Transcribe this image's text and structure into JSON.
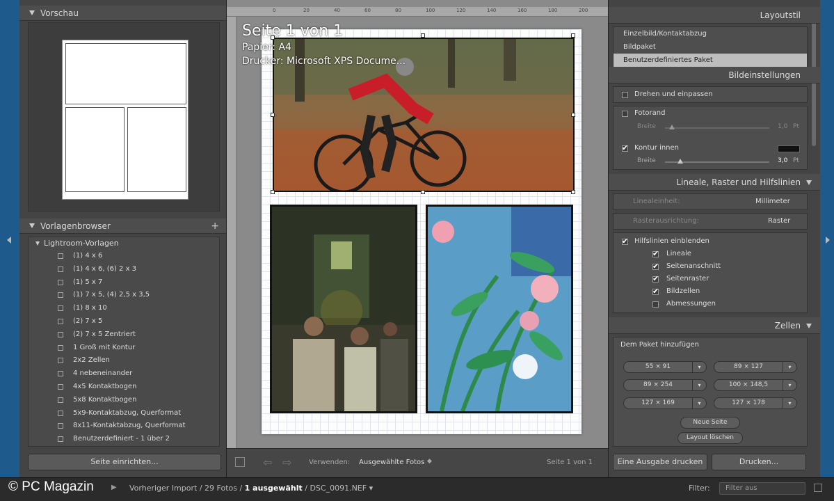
{
  "left_panel": {
    "preview_title": "Vorschau",
    "templates_title": "Vorlagenbrowser",
    "add_template": "+",
    "folder_name": "Lightroom-Vorlagen",
    "templates": [
      "(1) 4 x 6",
      "(1) 4 x 6, (6) 2 x 3",
      "(1) 5 x 7",
      "(1) 7 x 5, (4) 2,5 x 3,5",
      "(1) 8 x 10",
      "(2) 7 x 5",
      "(2) 7 x 5 Zentriert",
      "1 Groß mit Kontur",
      "2x2 Zellen",
      "4 nebeneinander",
      "4x5 Kontaktbogen",
      "5x8 Kontaktbogen",
      "5x9-Kontaktabzug, Querformat",
      "8x11-Kontaktabzug, Querformat",
      "Benutzerdefiniert - 1 über 2"
    ],
    "page_setup_button": "Seite einrichten..."
  },
  "center": {
    "page_title": "Seite 1 von 1",
    "paper": "Papier:  A4",
    "printer": "Drucker:  Microsoft XPS Docume...",
    "ruler_ticks": [
      "0",
      "20",
      "40",
      "60",
      "80",
      "100",
      "120",
      "140",
      "160",
      "180",
      "200"
    ],
    "use_label": "Verwenden:",
    "use_value": "Ausgewählte Fotos",
    "page_count": "Seite 1 von 1"
  },
  "right_panel": {
    "layout_style_title": "Layoutstil",
    "layout_options": [
      "Einzelbild/Kontaktabzug",
      "Bildpaket",
      "Benutzerdefiniertes Paket"
    ],
    "layout_selected_index": 2,
    "image_settings_title": "Bildeinstellungen",
    "rotate_fit": "Drehen und einpassen",
    "photo_border": "Fotorand",
    "photo_border_width_label": "Breite",
    "photo_border_value": "1,0",
    "inner_stroke": "Kontur innen",
    "inner_stroke_width_label": "Breite",
    "inner_stroke_value": "3,0",
    "unit_pt": "Pt",
    "stroke_color": "#111111",
    "rulers_title": "Lineale, Raster und Hilfslinien",
    "ruler_unit_label": "Linealeinheit:",
    "ruler_unit_value": "Millimeter",
    "grid_snap_label": "Rasterausrichtung:",
    "grid_snap_value": "Raster",
    "show_guides": "Hilfslinien einblenden",
    "guides": [
      {
        "label": "Lineale",
        "checked": true
      },
      {
        "label": "Seitenanschnitt",
        "checked": true
      },
      {
        "label": "Seitenraster",
        "checked": true
      },
      {
        "label": "Bildzellen",
        "checked": true
      },
      {
        "label": "Abmessungen",
        "checked": false
      }
    ],
    "cells_title": "Zellen",
    "add_to_package": "Dem Paket hinzufügen",
    "cell_sizes": [
      "55 × 91",
      "89 × 127",
      "89 × 254",
      "100 × 148,5",
      "127 × 169",
      "127 × 178"
    ],
    "new_page": "Neue Seite",
    "clear_layout": "Layout löschen",
    "print_one": "Eine Ausgabe drucken",
    "print": "Drucken..."
  },
  "bottom_bar": {
    "watermark": "© PC Magazin",
    "crumb_prev": "Vorheriger Import",
    "crumb_count": "29 Fotos",
    "crumb_selected": "1 ausgewählt",
    "crumb_file": "DSC_0091.NEF",
    "filter_label": "Filter:",
    "filter_value": "Filter aus"
  },
  "colors": {
    "accent_blue": "#1f5a8c",
    "panel_bg": "#444444",
    "canvas_bg": "#8a8a8a"
  }
}
